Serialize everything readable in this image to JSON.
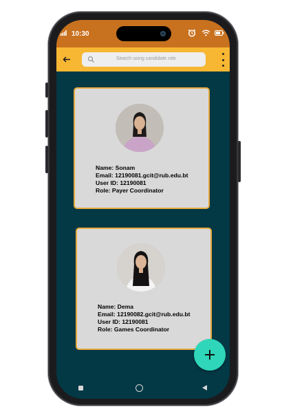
{
  "status_bar": {
    "time": "10:30",
    "icons": [
      "signal-icon",
      "alarm-icon",
      "wifi-icon",
      "battery-icon"
    ]
  },
  "app_bar": {
    "back_icon": "back-arrow-icon",
    "search_placeholder": "Search using candidate role",
    "menu_icon": "more-vert-icon",
    "color": "#f7b733"
  },
  "candidates": [
    {
      "name_line": "Name: Sonam",
      "email_line": "Email: 12190081.gcit@rub.edu.bt",
      "user_id_line": "User ID: 12190081",
      "role_line": "Role: Payer Coordinator"
    },
    {
      "name_line": "Name: Dema",
      "email_line": "Email: 12190082.gcit@rub.edu.bt",
      "user_id_line": "User ID: 12190081",
      "role_line": "Role: Games Coordinator"
    }
  ],
  "fab": {
    "icon": "add-icon",
    "label": "+"
  },
  "colors": {
    "background": "#033845",
    "status_bar": "#c8711f",
    "card": "#d9d9d9",
    "card_border": "#e6a93a",
    "fab": "#2fd6b9"
  }
}
